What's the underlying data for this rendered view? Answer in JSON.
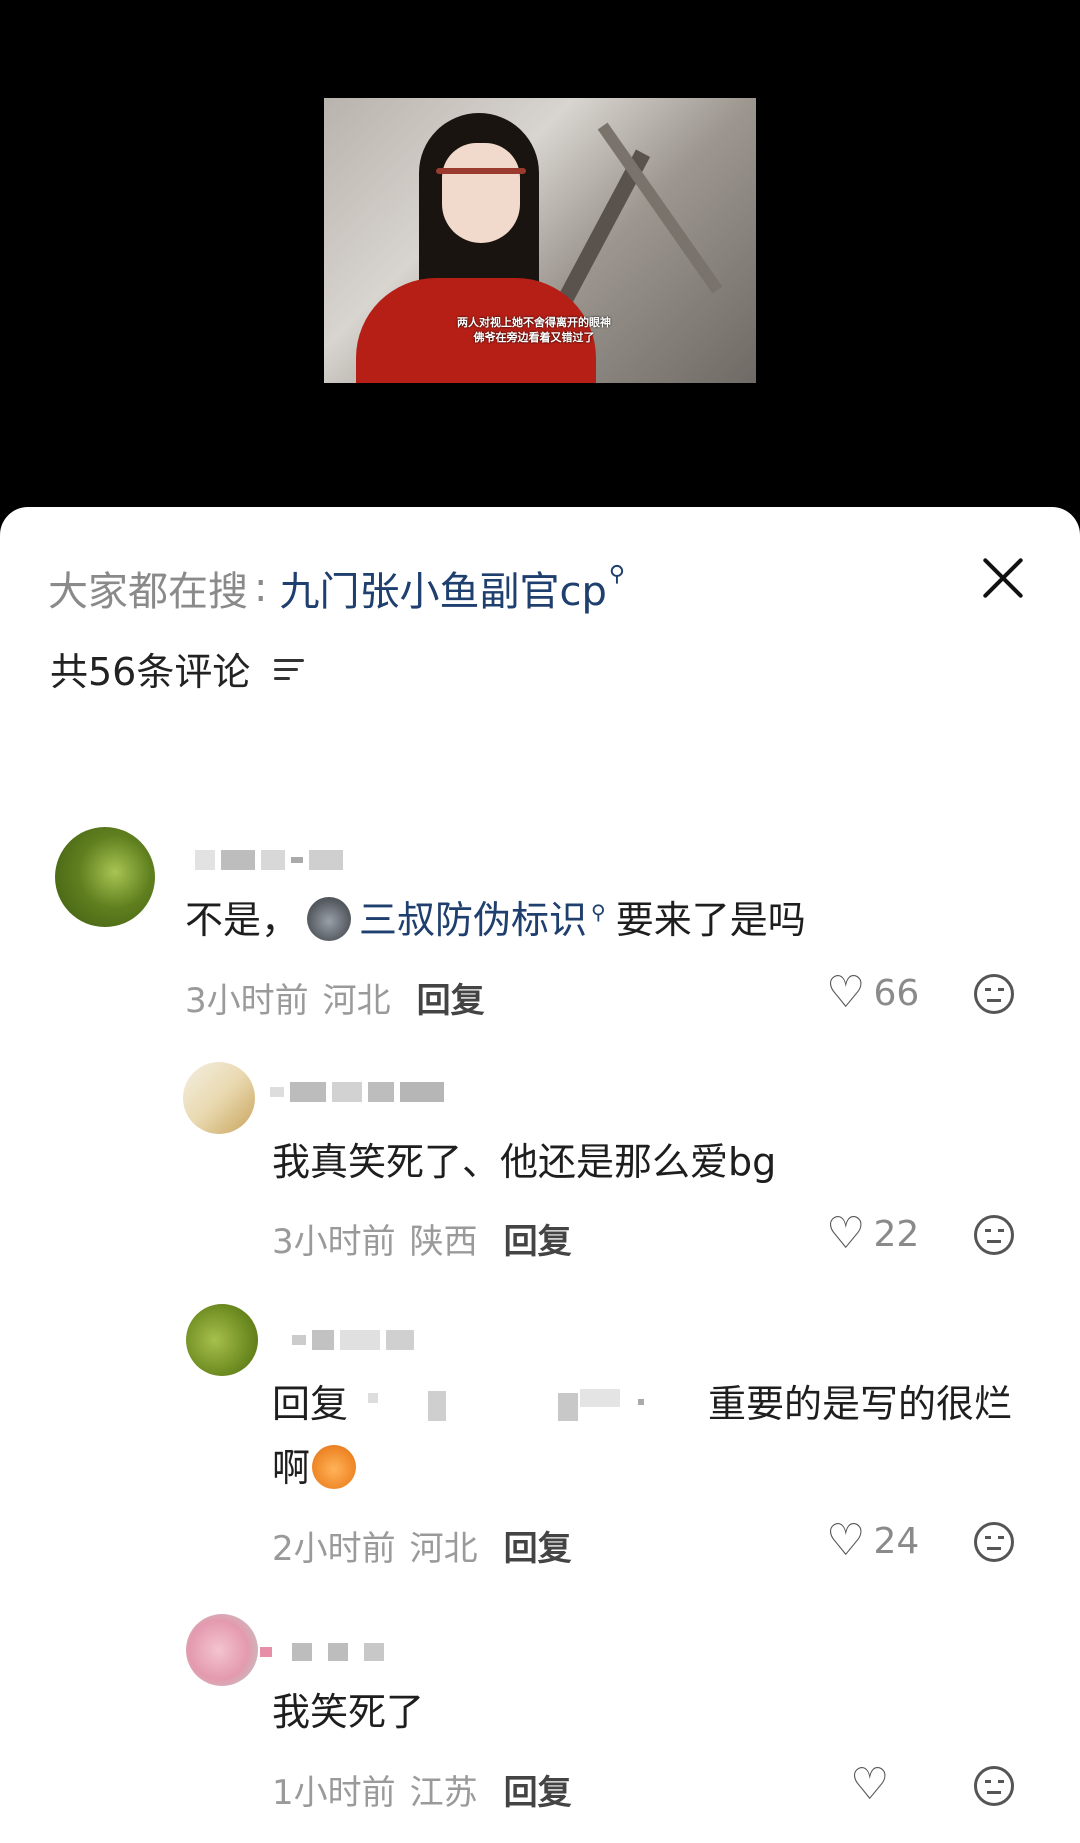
{
  "video": {
    "subtitle_line1": "两人对视上她不舍得离开的眼神",
    "subtitle_line2": "佛爷在旁边看着又错过了"
  },
  "header": {
    "search_prefix": "大家都在搜",
    "search_sep": ":",
    "search_term": "九门张小鱼副官cp",
    "search_icon": "magnifier-icon",
    "close_icon": "close-icon"
  },
  "comment_count": {
    "label": "共56条评论",
    "filter_icon": "filter-icon"
  },
  "comments": [
    {
      "text_before": "不是，",
      "emoji_icon": "cat-emoji",
      "link": "三叔防伪标识",
      "text_after": "要来了是吗",
      "time": "3小时前",
      "location": "河北",
      "reply_label": "回复",
      "likes": "66"
    },
    {
      "text": "我真笑死了、他还是那么爱bg",
      "time": "3小时前",
      "location": "陕西",
      "reply_label": "回复",
      "likes": "22"
    },
    {
      "text_line1_prefix": "回复",
      "text_line1_suffix": "重要的是写的很烂",
      "text_line2": "啊",
      "emoji_icon": "crying-cat-emoji",
      "time": "2小时前",
      "location": "河北",
      "reply_label": "回复",
      "likes": "24"
    },
    {
      "text": "我笑死了",
      "time": "1小时前",
      "location": "江苏",
      "reply_label": "回复",
      "likes": ""
    }
  ],
  "colors": {
    "link": "#1f3f6e",
    "meta_gray": "#9a9a9a",
    "sheet_bg": "#ffffff",
    "top_bg": "#000000"
  }
}
